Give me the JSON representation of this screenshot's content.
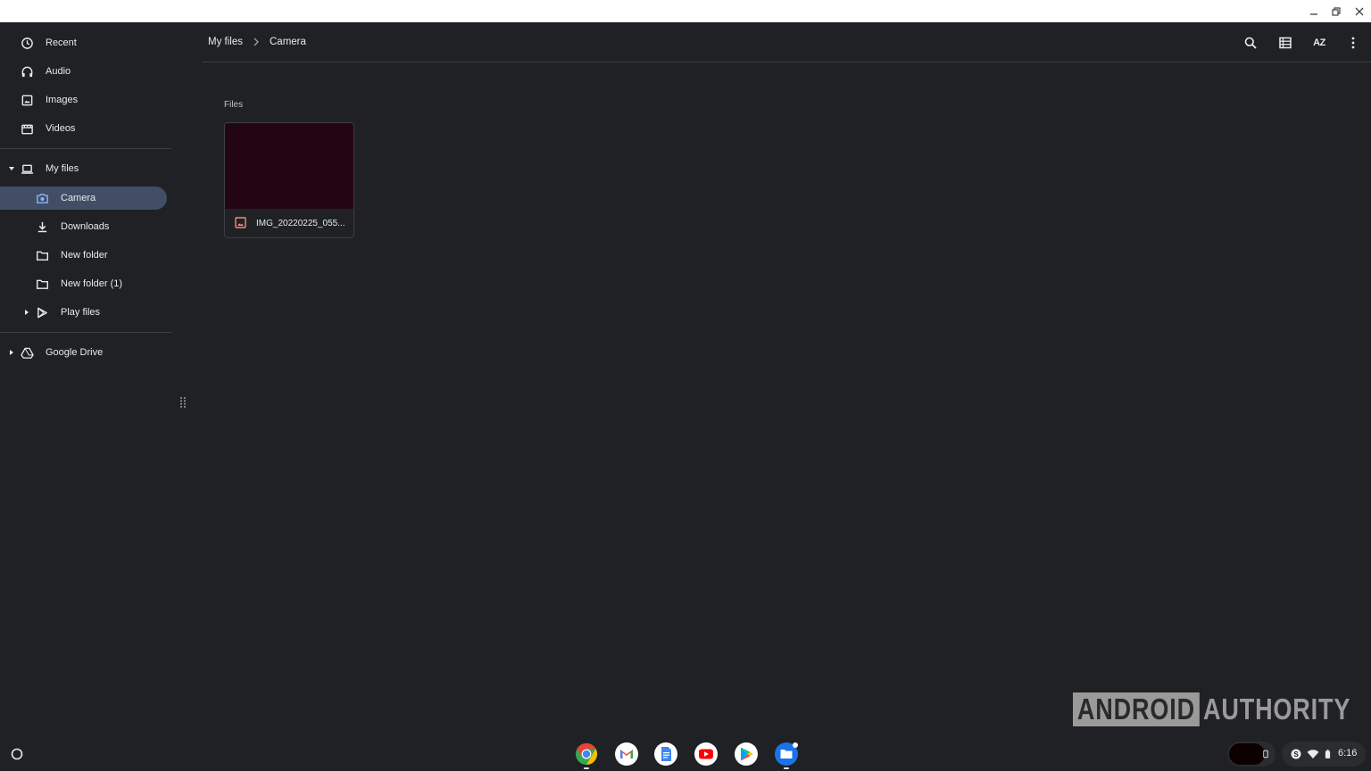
{
  "window": {
    "buttons": [
      "minimize",
      "restore",
      "close"
    ]
  },
  "sidebar": {
    "quick": [
      {
        "label": "Recent",
        "icon": "clock-icon"
      },
      {
        "label": "Audio",
        "icon": "headphones-icon"
      },
      {
        "label": "Images",
        "icon": "image-icon"
      },
      {
        "label": "Videos",
        "icon": "video-icon"
      }
    ],
    "my_files": {
      "label": "My files",
      "icon": "laptop-icon",
      "expanded": true
    },
    "children": [
      {
        "label": "Camera",
        "icon": "camera-icon",
        "selected": true
      },
      {
        "label": "Downloads",
        "icon": "download-icon"
      },
      {
        "label": "New folder",
        "icon": "folder-icon"
      },
      {
        "label": "New folder (1)",
        "icon": "folder-icon"
      },
      {
        "label": "Play files",
        "icon": "play-store-icon",
        "expandable": true
      }
    ],
    "drive": {
      "label": "Google Drive",
      "icon": "drive-icon",
      "expandable": true
    }
  },
  "breadcrumb": {
    "root": "My files",
    "current": "Camera"
  },
  "toolbar": {
    "sort_label": "AZ",
    "icons": [
      "search-icon",
      "list-view-icon",
      "sort-icon",
      "more-icon"
    ]
  },
  "content": {
    "section_label": "Files",
    "files": [
      {
        "name": "IMG_20220225_055...",
        "type": "image",
        "thumb_color": "#240512"
      }
    ]
  },
  "watermark": {
    "box_text": "ANDROID",
    "text": "AUTHORITY"
  },
  "shelf": {
    "apps": [
      "chrome-icon",
      "gmail-icon",
      "docs-icon",
      "youtube-icon",
      "play-store-icon",
      "files-app-icon"
    ],
    "time": "6:16"
  },
  "colors": {
    "background": "#202124",
    "selected": "#414e65",
    "text": "#e8eaed",
    "accent_blue": "#8ab4f8",
    "image_red": "#f28b82"
  }
}
